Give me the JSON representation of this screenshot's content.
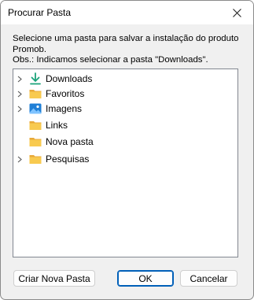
{
  "window": {
    "title": "Procurar Pasta"
  },
  "description": {
    "line1": "Selecione uma pasta para salvar a instalação do produto",
    "line2": "Promob.",
    "line3": "Obs.: Indicamos selecionar a pasta \"Downloads\"."
  },
  "tree": {
    "items": [
      {
        "label": "Downloads",
        "icon": "download-icon",
        "expandable": true
      },
      {
        "label": "Favoritos",
        "icon": "folder-icon",
        "expandable": true
      },
      {
        "label": "Imagens",
        "icon": "pictures-icon",
        "expandable": true
      },
      {
        "label": "Links",
        "icon": "folder-icon",
        "expandable": false
      },
      {
        "label": "Nova pasta",
        "icon": "folder-icon",
        "expandable": false
      },
      {
        "label": "Pesquisas",
        "icon": "folder-icon",
        "expandable": true
      }
    ]
  },
  "buttons": {
    "new_folder": "Criar Nova Pasta",
    "ok": "OK",
    "cancel": "Cancelar"
  },
  "colors": {
    "folder": "#f5c542",
    "download_arrow": "#1aa37a",
    "accent": "#005fb8"
  }
}
